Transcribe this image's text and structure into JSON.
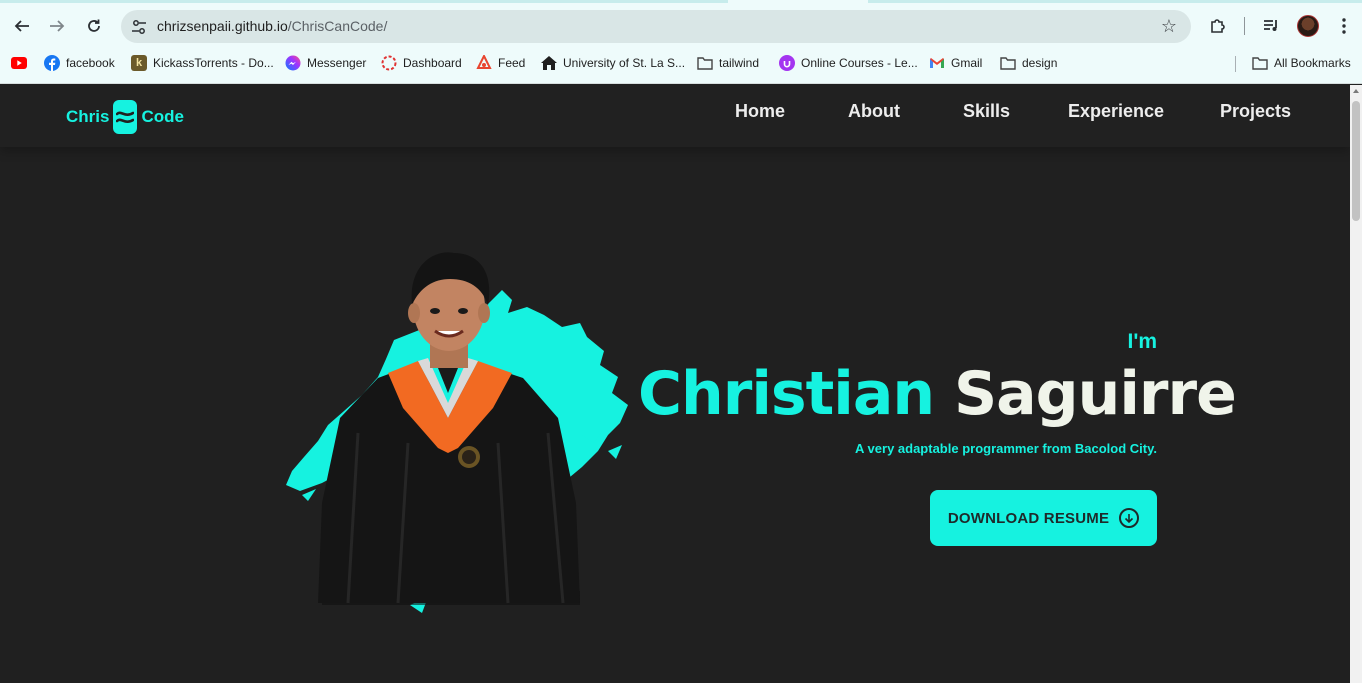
{
  "browser": {
    "url_host": "chrizsenpaii.github.io",
    "url_path": "/ChrisCanCode/",
    "icons": {
      "back": "arrow-left-icon",
      "forward": "arrow-right-icon",
      "reload": "reload-icon",
      "site_info": "tune-icon",
      "bookmark_star": "star-icon",
      "extensions": "puzzle-icon",
      "media": "queue-music-icon",
      "profile": "avatar",
      "menu": "kebab-menu-icon"
    }
  },
  "bookmarks": [
    {
      "label": "",
      "icon": "youtube-icon",
      "color": "#ff0000"
    },
    {
      "label": "facebook",
      "icon": "facebook-icon",
      "color": "#1877f2"
    },
    {
      "label": "KickassTorrents - Do...",
      "icon": "kickass-icon",
      "color": "#6b5a2a"
    },
    {
      "label": "Messenger",
      "icon": "messenger-icon",
      "color": "#7b5cff"
    },
    {
      "label": "Dashboard",
      "icon": "dashboard-icon",
      "color": "#e03131"
    },
    {
      "label": "Feed",
      "icon": "feed-icon",
      "color": "#e8452f"
    },
    {
      "label": "University of St. La S...",
      "icon": "home-icon",
      "color": "#1f1f1f"
    },
    {
      "label": "tailwind",
      "icon": "folder-icon",
      "color": "#444"
    },
    {
      "label": "Online Courses - Le...",
      "icon": "udemy-icon",
      "color": "#a435f0"
    },
    {
      "label": "Gmail",
      "icon": "gmail-icon",
      "color": "#ea4335"
    },
    {
      "label": "design",
      "icon": "folder-icon",
      "color": "#444"
    }
  ],
  "all_bookmarks_label": "All Bookmarks",
  "site": {
    "logo_left": "Chris",
    "logo_right": "Code",
    "nav": [
      "Home",
      "About",
      "Skills",
      "Experience",
      "Projects"
    ],
    "accent": "#16f2e0",
    "background": "#202020"
  },
  "hero": {
    "greeting": "I'm",
    "first_name": "Christian",
    "last_name": "Saguirre",
    "tagline": "A very adaptable programmer from Bacolod City.",
    "cta_label": "DOWNLOAD RESUME",
    "cta_icon": "download-circle-icon"
  }
}
